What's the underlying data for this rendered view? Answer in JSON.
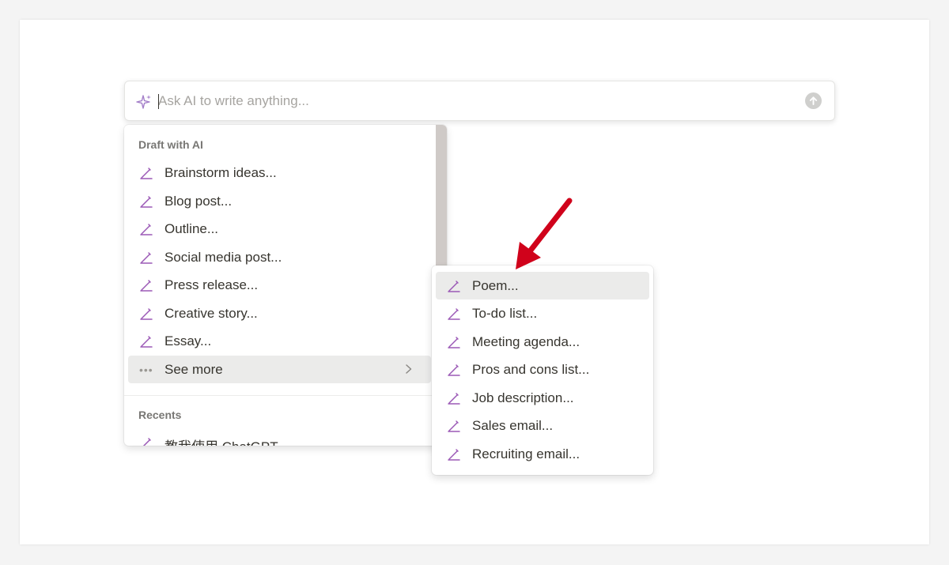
{
  "ai_bar": {
    "placeholder": "Ask AI to write anything..."
  },
  "draft_menu": {
    "section_label": "Draft with AI",
    "items": [
      {
        "label": "Brainstorm ideas...",
        "icon": "pen-icon"
      },
      {
        "label": "Blog post...",
        "icon": "pen-icon"
      },
      {
        "label": "Outline...",
        "icon": "pen-icon"
      },
      {
        "label": "Social media post...",
        "icon": "pen-icon"
      },
      {
        "label": "Press release...",
        "icon": "pen-icon"
      },
      {
        "label": "Creative story...",
        "icon": "pen-icon"
      },
      {
        "label": "Essay...",
        "icon": "pen-icon"
      }
    ],
    "see_more_label": "See more",
    "recents_label": "Recents",
    "recents": [
      {
        "label": "教我使用 ChatGPT",
        "icon": "pen-icon"
      }
    ]
  },
  "submenu": {
    "items": [
      {
        "label": "Poem...",
        "icon": "pen-icon",
        "highlighted": true
      },
      {
        "label": "To-do list...",
        "icon": "pen-icon"
      },
      {
        "label": "Meeting agenda...",
        "icon": "pen-icon"
      },
      {
        "label": "Pros and cons list...",
        "icon": "pen-icon"
      },
      {
        "label": "Job description...",
        "icon": "pen-icon"
      },
      {
        "label": "Sales email...",
        "icon": "pen-icon"
      },
      {
        "label": "Recruiting email...",
        "icon": "pen-icon"
      }
    ]
  },
  "colors": {
    "accent_purple": "#9b59b6",
    "highlight_bg": "#ebebea",
    "arrow_red": "#d0021b",
    "text": "#37352f",
    "muted_text": "#787774"
  }
}
